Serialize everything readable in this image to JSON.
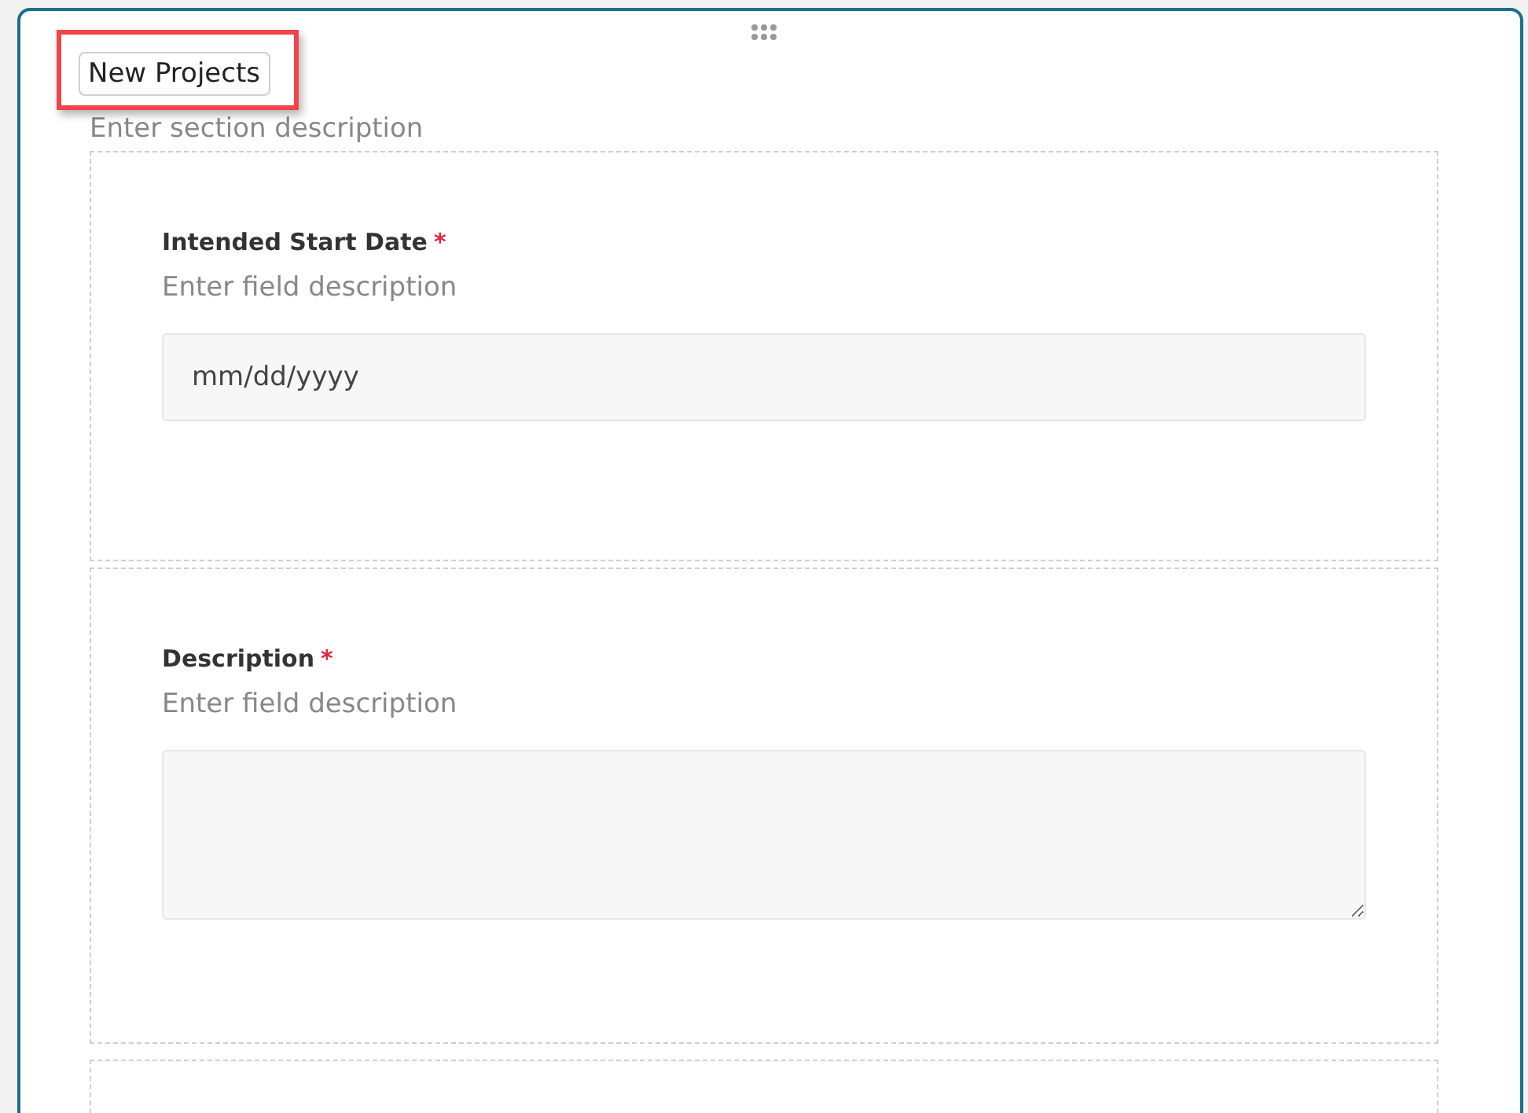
{
  "section": {
    "title": "New Projects",
    "title_highlighted": true,
    "description_placeholder": "Enter section description"
  },
  "fields": [
    {
      "kind": "date",
      "label": "Intended Start Date",
      "required": true,
      "description_placeholder": "Enter field description",
      "placeholder": "mm/dd/yyyy"
    },
    {
      "kind": "textarea",
      "label": "Description",
      "required": true,
      "description_placeholder": "Enter field description"
    }
  ],
  "required_mark": "*"
}
